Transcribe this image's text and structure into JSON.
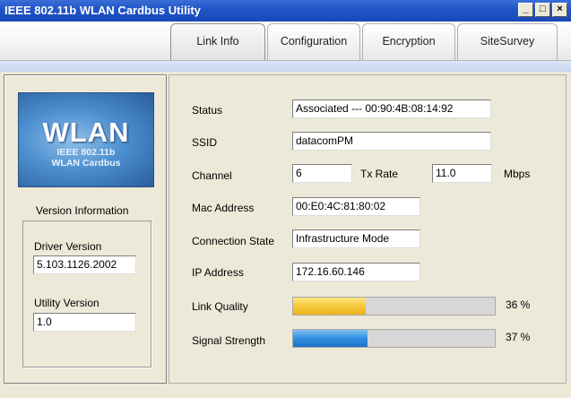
{
  "window": {
    "title": "IEEE 802.11b WLAN Cardbus Utility",
    "minimize": "_",
    "restore": "□",
    "close": "×"
  },
  "tabs": [
    {
      "label": "Link Info",
      "active": true
    },
    {
      "label": "Configuration"
    },
    {
      "label": "Encryption"
    },
    {
      "label": "SiteSurvey"
    }
  ],
  "logo": {
    "main": "WLAN",
    "line1": "IEEE 802.11b",
    "line2": "WLAN Cardbus"
  },
  "version": {
    "heading": "Version Information",
    "driver_label": "Driver Version",
    "driver_value": "5.103.1126.2002",
    "utility_label": "Utility Version",
    "utility_value": "1.0"
  },
  "link": {
    "status_label": "Status",
    "status_value": "Associated --- 00:90:4B:08:14:92",
    "ssid_label": "SSID",
    "ssid_value": "datacomPM",
    "channel_label": "Channel",
    "channel_value": "6",
    "txrate_label": "Tx Rate",
    "txrate_value": "11.0",
    "txrate_unit": "Mbps",
    "mac_label": "Mac Address",
    "mac_value": "00:E0:4C:81:80:02",
    "conn_label": "Connection State",
    "conn_value": "Infrastructure Mode",
    "ip_label": "IP Address",
    "ip_value": "172.16.60.146",
    "quality_label": "Link Quality",
    "quality_percent": 36,
    "quality_text": "36 %",
    "signal_label": "Signal Strength",
    "signal_percent": 37,
    "signal_text": "37 %"
  },
  "colors": {
    "titlebar": "#2156c8",
    "quality_bar": "#f6c93a",
    "signal_bar": "#2f8fe0"
  }
}
